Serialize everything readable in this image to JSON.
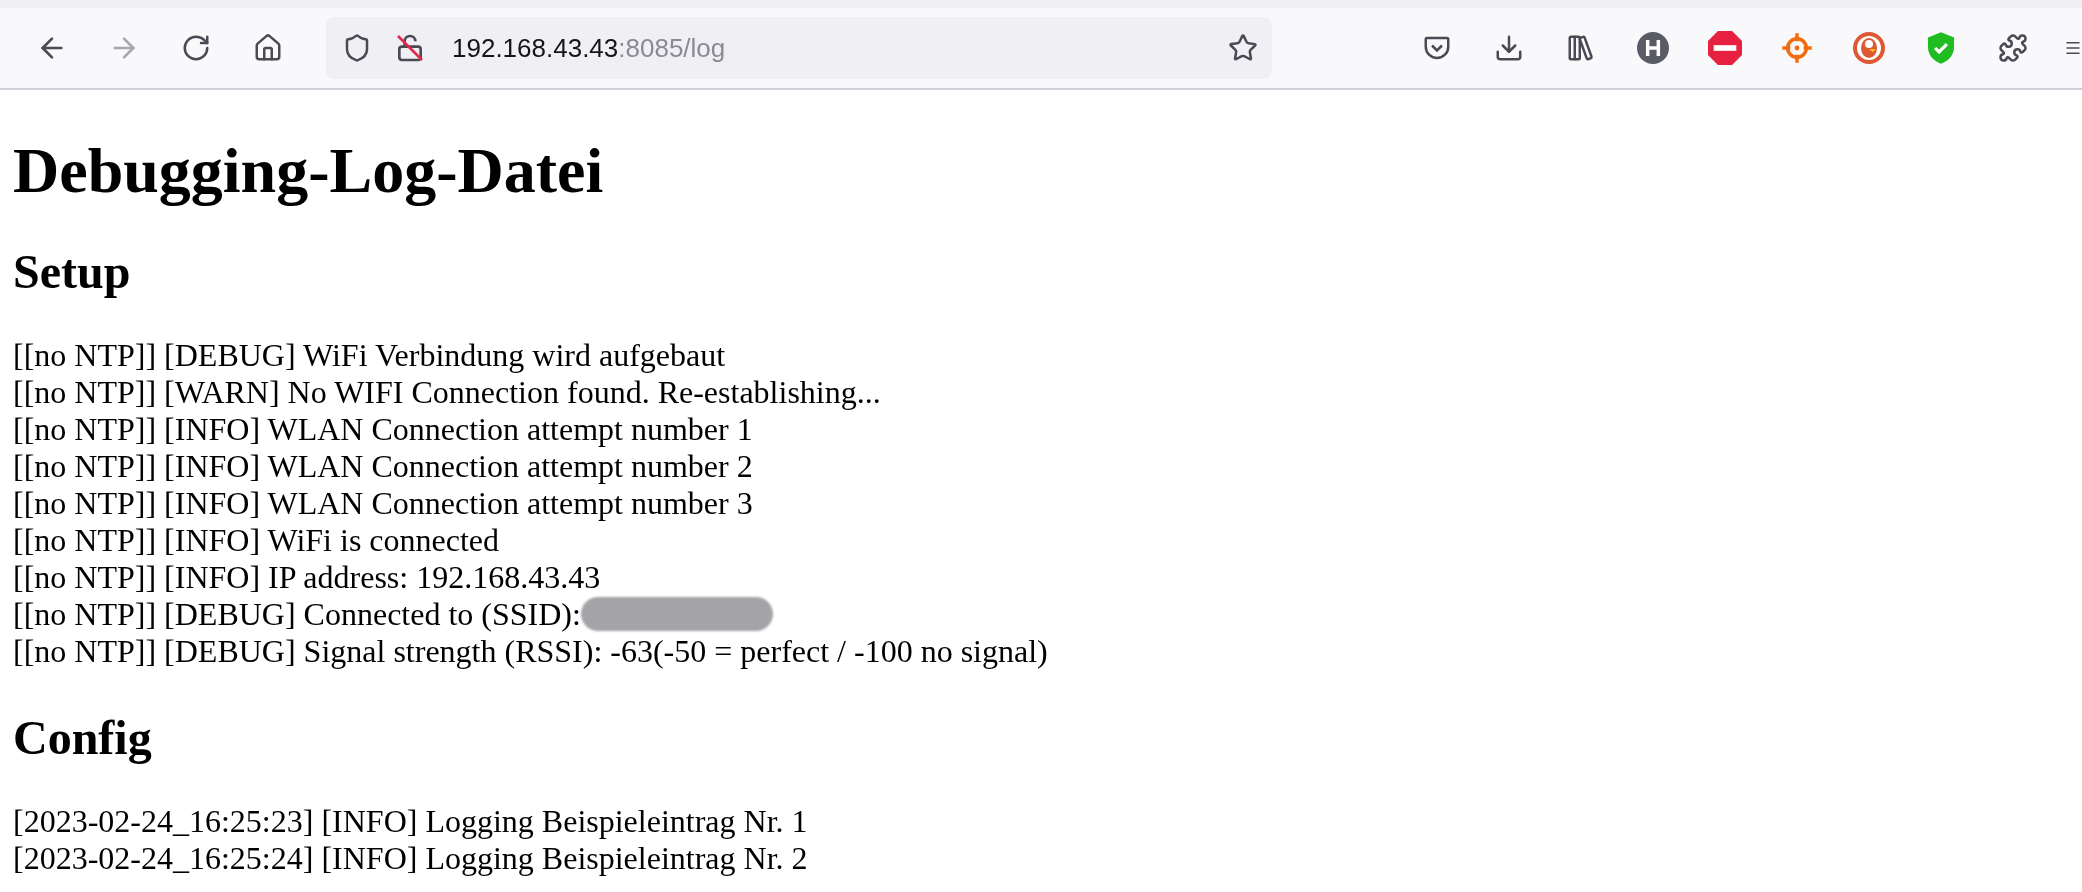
{
  "browser": {
    "url": {
      "host": "192.168.43.43",
      "path": ":8085/log"
    },
    "forward_disabled": true
  },
  "page": {
    "title": "Debugging-Log-Datei",
    "sections": [
      {
        "heading": "Setup",
        "lines": [
          {
            "text": "[[no NTP]] [DEBUG] WiFi Verbindung wird aufgebaut"
          },
          {
            "text": "[[no NTP]] [WARN] No WIFI Connection found. Re-establishing..."
          },
          {
            "text": "[[no NTP]] [INFO] WLAN Connection attempt number 1"
          },
          {
            "text": "[[no NTP]] [INFO] WLAN Connection attempt number 2"
          },
          {
            "text": "[[no NTP]] [INFO] WLAN Connection attempt number 3"
          },
          {
            "text": "[[no NTP]] [INFO] WiFi is connected"
          },
          {
            "text": "[[no NTP]] [INFO] IP address: 192.168.43.43"
          },
          {
            "text": "[[no NTP]] [DEBUG] Connected to (SSID):",
            "redacted": true
          },
          {
            "text": "[[no NTP]] [DEBUG] Signal strength (RSSI): -63(-50 = perfect / -100 no signal)"
          }
        ]
      },
      {
        "heading": "Config",
        "lines": [
          {
            "text": "[2023-02-24_16:25:23] [INFO] Logging Beispieleintrag Nr. 1"
          },
          {
            "text": "[2023-02-24_16:25:24] [INFO] Logging Beispieleintrag Nr. 2"
          }
        ]
      }
    ]
  }
}
